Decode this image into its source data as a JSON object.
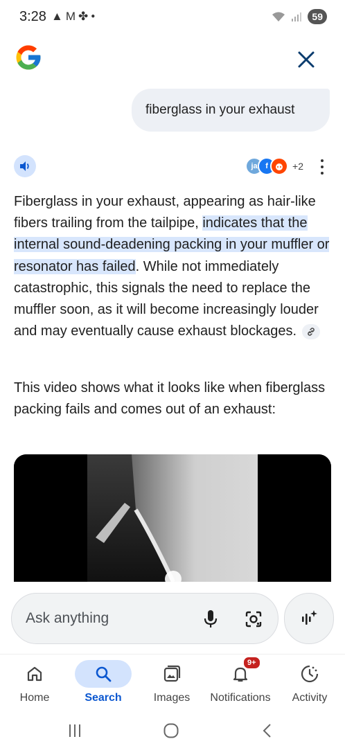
{
  "status_bar": {
    "time": "3:28",
    "notification_icons": [
      "alert-triangle-icon",
      "gmail-icon",
      "pinwheel-icon",
      "dot-icon"
    ],
    "battery": "59"
  },
  "header": {
    "logo": "google-g-logo",
    "close_icon": "close-icon"
  },
  "query": {
    "text": "fiberglass in your exhaust"
  },
  "answer": {
    "sources": [
      "ja",
      "f",
      "reddit"
    ],
    "sources_more": "+2",
    "text_before": "Fiberglass in your exhaust, appearing as hair-like fibers trailing from the tailpipe, ",
    "text_highlight": "indicates that the internal sound-deadening packing in your muffler or resonator has failed",
    "text_after": ". While not immediately catastrophic, this signals the need to replace the muffler soon, as it will become increasingly louder and may eventually cause exhaust blockages.",
    "video_intro": "This video shows what it looks like when fiberglass packing fails and comes out of an exhaust:"
  },
  "search": {
    "placeholder": "Ask anything"
  },
  "bottom_nav": {
    "items": [
      {
        "label": "Home",
        "icon": "home-icon"
      },
      {
        "label": "Search",
        "icon": "search-icon"
      },
      {
        "label": "Images",
        "icon": "images-icon"
      },
      {
        "label": "Notifications",
        "icon": "bell-icon",
        "badge": "9+"
      },
      {
        "label": "Activity",
        "icon": "activity-icon"
      }
    ],
    "active": "Search"
  },
  "colors": {
    "accent": "#0b57d0",
    "highlight": "#d8e6fc",
    "badge": "#c5221f"
  }
}
